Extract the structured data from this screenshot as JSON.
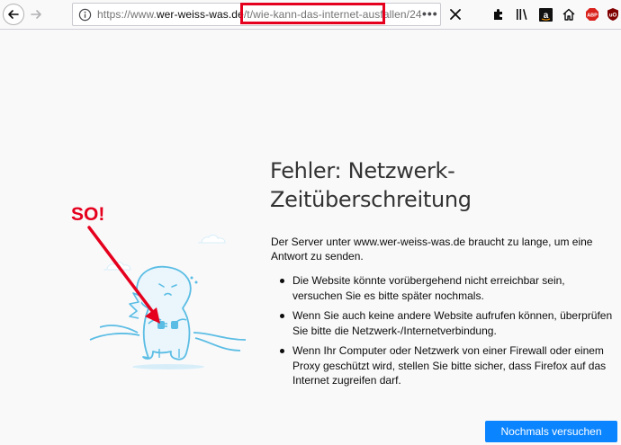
{
  "browser": {
    "url_prefix": "https://www.",
    "url_domain": "wer-weiss-was.de",
    "url_path": "/t/wie-kann-das-internet-ausfallen/24",
    "menu_dots": "•••"
  },
  "error_page": {
    "title": "Fehler: Netzwerk-Zeitüberschreitung",
    "intro": "Der Server unter www.wer-weiss-was.de braucht zu lange, um eine Antwort zu senden.",
    "bullets": [
      "Die Website könnte vorübergehend nicht erreichbar sein, versuchen Sie es bitte später nochmals.",
      "Wenn Sie auch keine andere Website aufrufen können, überprüfen Sie bitte die Netzwerk-/Internetverbindung.",
      "Wenn Ihr Computer oder Netzwerk von einer Firewall oder einem Proxy geschützt wird, stellen Sie bitte sicher, dass Firefox auf das Internet zugreifen darf."
    ],
    "retry_button": "Nochmals versuchen"
  },
  "annotation": {
    "label": "SO!",
    "color": "#e5001d"
  },
  "colors": {
    "accent": "#0a84ff",
    "dino_outline": "#5bbde4",
    "annotation_red": "#e5001d"
  }
}
